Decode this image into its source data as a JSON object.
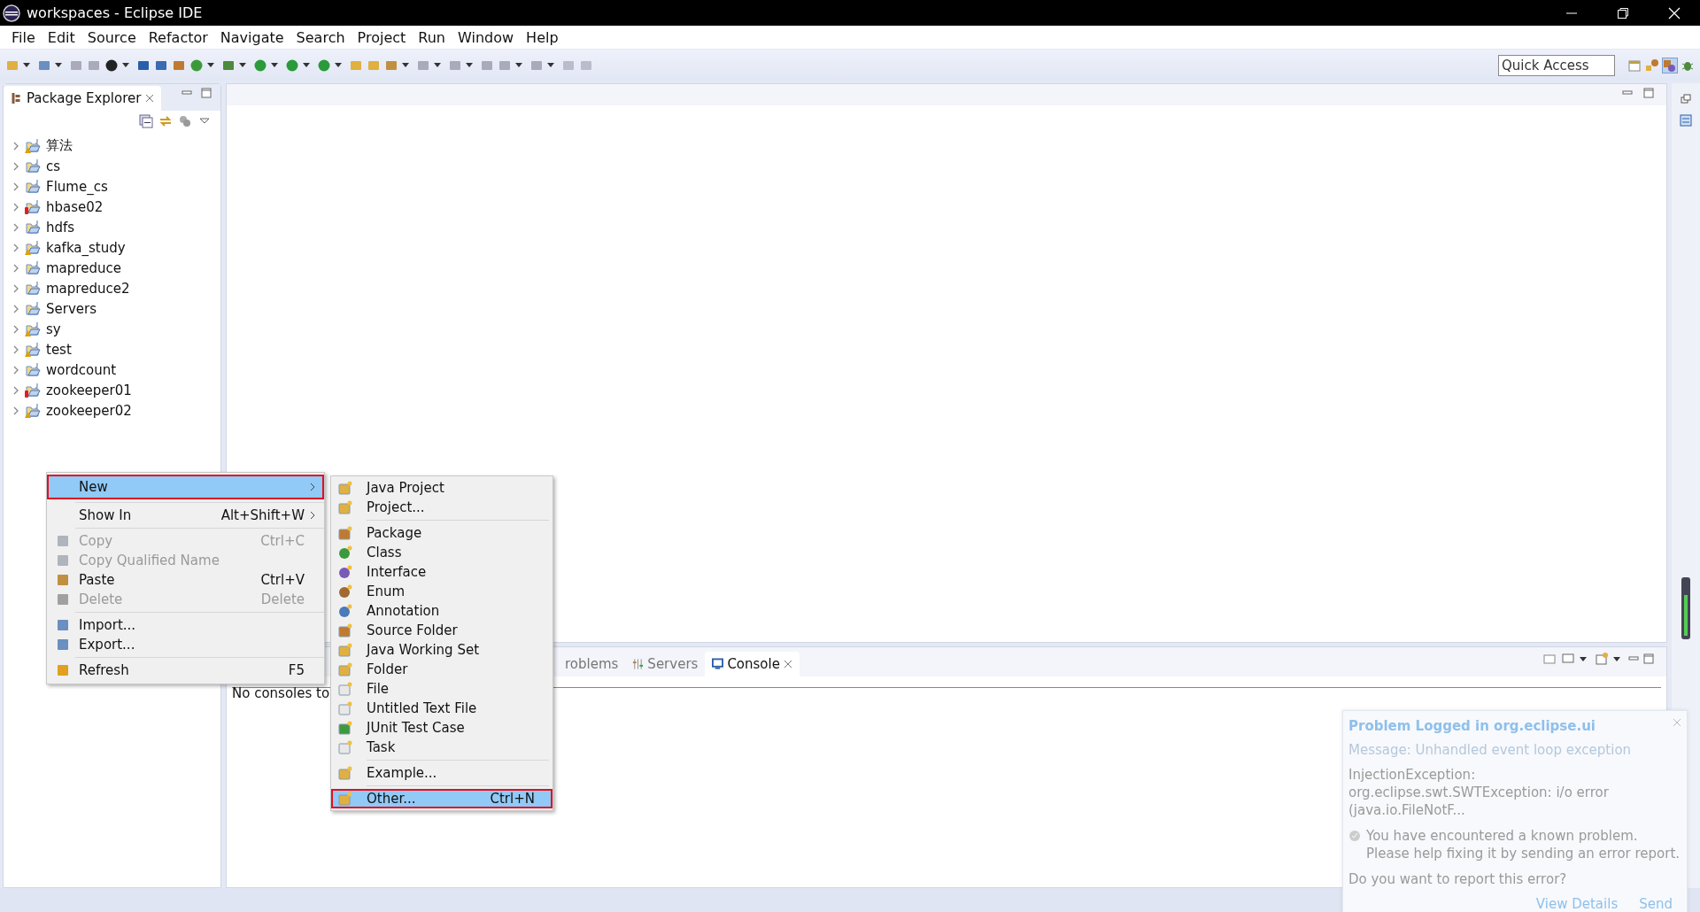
{
  "window": {
    "title": "workspaces - Eclipse IDE"
  },
  "menu_bar": [
    "File",
    "Edit",
    "Source",
    "Refactor",
    "Navigate",
    "Search",
    "Project",
    "Run",
    "Window",
    "Help"
  ],
  "quick_access": {
    "placeholder": "Quick Access"
  },
  "package_explorer": {
    "title": "Package Explorer",
    "projects": [
      {
        "name": "算法",
        "expanded": false,
        "warning": true,
        "error": false
      },
      {
        "name": "cs",
        "expanded": false,
        "warning": false,
        "error": false
      },
      {
        "name": "Flume_cs",
        "expanded": false,
        "warning": false,
        "error": false
      },
      {
        "name": "hbase02",
        "expanded": false,
        "warning": false,
        "error": true
      },
      {
        "name": "hdfs",
        "expanded": false,
        "warning": false,
        "error": false
      },
      {
        "name": "kafka_study",
        "expanded": false,
        "warning": true,
        "error": false
      },
      {
        "name": "mapreduce",
        "expanded": false,
        "warning": false,
        "error": false
      },
      {
        "name": "mapreduce2",
        "expanded": false,
        "warning": false,
        "error": false
      },
      {
        "name": "Servers",
        "expanded": false,
        "warning": false,
        "error": false
      },
      {
        "name": "sy",
        "expanded": false,
        "warning": true,
        "error": false
      },
      {
        "name": "test",
        "expanded": false,
        "warning": true,
        "error": false
      },
      {
        "name": "wordcount",
        "expanded": false,
        "warning": false,
        "error": false
      },
      {
        "name": "zookeeper01",
        "expanded": false,
        "warning": false,
        "error": true
      },
      {
        "name": "zookeeper02",
        "expanded": false,
        "warning": true,
        "error": false
      }
    ]
  },
  "bottom_panel": {
    "tabs": [
      {
        "label": "roblems",
        "selected": false
      },
      {
        "label": "Servers",
        "selected": false
      },
      {
        "label": "Console",
        "selected": true
      }
    ],
    "console_text": "No consoles to"
  },
  "context_menu": [
    {
      "kind": "item",
      "label": "New",
      "submenu": true,
      "disabled": false,
      "selected": true,
      "highlighted": true
    },
    {
      "kind": "separator"
    },
    {
      "kind": "item",
      "label": "Show In",
      "shortcut": "Alt+Shift+W",
      "submenu": true,
      "disabled": false,
      "selected": false,
      "highlighted": false
    },
    {
      "kind": "separator"
    },
    {
      "kind": "item",
      "label": "Copy",
      "shortcut": "Ctrl+C",
      "submenu": false,
      "disabled": true,
      "selected": false,
      "highlighted": false
    },
    {
      "kind": "item",
      "label": "Copy Qualified Name",
      "submenu": false,
      "disabled": true,
      "selected": false,
      "highlighted": false
    },
    {
      "kind": "item",
      "label": "Paste",
      "shortcut": "Ctrl+V",
      "submenu": false,
      "disabled": false,
      "selected": false,
      "highlighted": false
    },
    {
      "kind": "item",
      "label": "Delete",
      "shortcut": "Delete",
      "submenu": false,
      "disabled": true,
      "selected": false,
      "highlighted": false
    },
    {
      "kind": "separator"
    },
    {
      "kind": "item",
      "label": "Import...",
      "submenu": false,
      "disabled": false,
      "selected": false,
      "highlighted": false
    },
    {
      "kind": "item",
      "label": "Export...",
      "submenu": false,
      "disabled": false,
      "selected": false,
      "highlighted": false
    },
    {
      "kind": "separator"
    },
    {
      "kind": "item",
      "label": "Refresh",
      "shortcut": "F5",
      "submenu": false,
      "disabled": false,
      "selected": false,
      "highlighted": false
    }
  ],
  "new_submenu": [
    {
      "kind": "item",
      "label": "Java Project",
      "selected": false,
      "highlighted": false
    },
    {
      "kind": "item",
      "label": "Project...",
      "selected": false,
      "highlighted": false
    },
    {
      "kind": "separator"
    },
    {
      "kind": "item",
      "label": "Package",
      "selected": false,
      "highlighted": false
    },
    {
      "kind": "item",
      "label": "Class",
      "selected": false,
      "highlighted": false
    },
    {
      "kind": "item",
      "label": "Interface",
      "selected": false,
      "highlighted": false
    },
    {
      "kind": "item",
      "label": "Enum",
      "selected": false,
      "highlighted": false
    },
    {
      "kind": "item",
      "label": "Annotation",
      "selected": false,
      "highlighted": false
    },
    {
      "kind": "item",
      "label": "Source Folder",
      "selected": false,
      "highlighted": false
    },
    {
      "kind": "item",
      "label": "Java Working Set",
      "selected": false,
      "highlighted": false
    },
    {
      "kind": "item",
      "label": "Folder",
      "selected": false,
      "highlighted": false
    },
    {
      "kind": "item",
      "label": "File",
      "selected": false,
      "highlighted": false
    },
    {
      "kind": "item",
      "label": "Untitled Text File",
      "selected": false,
      "highlighted": false
    },
    {
      "kind": "item",
      "label": "JUnit Test Case",
      "selected": false,
      "highlighted": false
    },
    {
      "kind": "item",
      "label": "Task",
      "selected": false,
      "highlighted": false
    },
    {
      "kind": "separator"
    },
    {
      "kind": "item",
      "label": "Example...",
      "selected": false,
      "highlighted": false
    },
    {
      "kind": "separator"
    },
    {
      "kind": "item",
      "label": "Other...",
      "shortcut": "Ctrl+N",
      "selected": true,
      "highlighted": true
    }
  ],
  "notification": {
    "title": "Problem Logged in org.eclipse.ui",
    "message": "Message: Unhandled event loop exception",
    "detail": "InjectionException: org.eclipse.swt.SWTException: i/o error (java.io.FileNotF...",
    "info": "You have encountered a known problem. Please help fixing it by sending an error report.",
    "question": "Do you want to report this error?",
    "actions": [
      "View Details",
      "Send"
    ]
  }
}
